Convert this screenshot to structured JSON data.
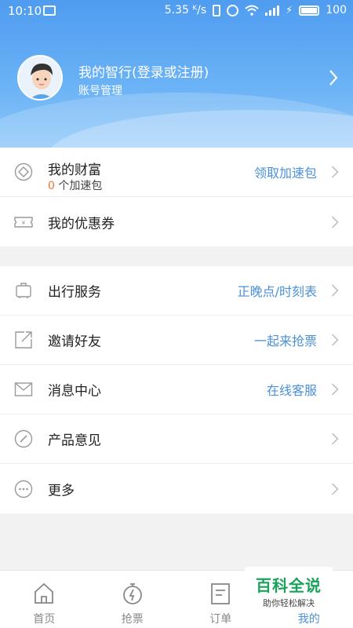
{
  "status_bar": {
    "time": "10:10",
    "speed": "5.35 ᴷ/s",
    "battery": "100"
  },
  "profile": {
    "title": "我的智行(登录或注册)",
    "subtitle": "账号管理"
  },
  "group1": [
    {
      "label": "我的财富",
      "sub_count": "0",
      "sub_text": " 个加速包",
      "value": "领取加速包",
      "icon": "diamond-icon"
    },
    {
      "label": "我的优惠券",
      "value": "",
      "icon": "ticket-icon"
    }
  ],
  "group2": [
    {
      "label": "出行服务",
      "value": "正晚点/时刻表",
      "icon": "suitcase-icon"
    },
    {
      "label": "邀请好友",
      "value": "一起来抢票",
      "icon": "share-icon"
    },
    {
      "label": "消息中心",
      "value": "在线客服",
      "icon": "mail-icon"
    },
    {
      "label": "产品意见",
      "value": "",
      "icon": "pencil-icon"
    },
    {
      "label": "更多",
      "value": "",
      "icon": "more-icon"
    }
  ],
  "tabs": [
    {
      "label": "首页",
      "icon": "home-icon",
      "active": false
    },
    {
      "label": "抢票",
      "icon": "stopwatch-icon",
      "active": false
    },
    {
      "label": "订单",
      "icon": "order-icon",
      "active": false
    },
    {
      "label": "我的",
      "icon": "profile-icon",
      "active": true
    }
  ],
  "watermark": {
    "title": "百科全说",
    "subtitle": "助你轻松解决"
  },
  "colors": {
    "header_top": "#4f9cf0",
    "accent": "#4a90d9",
    "count_orange": "#f0722c"
  }
}
